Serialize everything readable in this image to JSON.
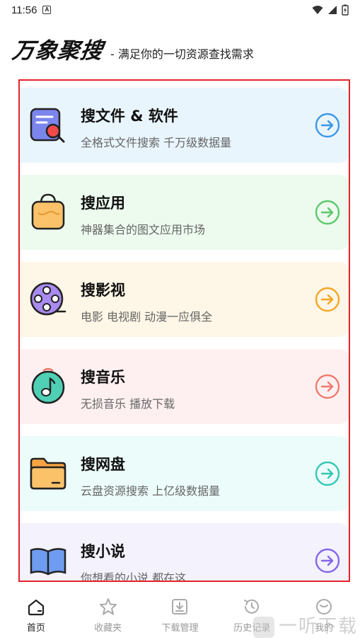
{
  "status_bar": {
    "time": "11:56",
    "notification_glyph": "A"
  },
  "header": {
    "title": "万象聚搜",
    "subtitle": "- 满足你的一切资源查找需求"
  },
  "cards": [
    {
      "title": "搜文件 & 软件",
      "desc": "全格式文件搜索 千万级数据量",
      "icon": "file-search-icon",
      "bg": "#e9f5fd",
      "accent": "#3a97e8"
    },
    {
      "title": "搜应用",
      "desc": "神器集合的图文应用市场",
      "icon": "shopping-bag-icon",
      "bg": "#edfbef",
      "accent": "#5cc86a"
    },
    {
      "title": "搜影视",
      "desc": "电影 电视剧 动漫一应俱全",
      "icon": "film-reel-icon",
      "bg": "#fef6e6",
      "accent": "#f5a623"
    },
    {
      "title": "搜音乐",
      "desc": "无损音乐 播放下载",
      "icon": "music-note-icon",
      "bg": "#fef0f0",
      "accent": "#f07b6e"
    },
    {
      "title": "搜网盘",
      "desc": "云盘资源搜索 上亿级数据量",
      "icon": "folder-icon",
      "bg": "#ecfcfa",
      "accent": "#33c7b2"
    },
    {
      "title": "搜小说",
      "desc": "你想看的小说 都在这",
      "icon": "book-icon",
      "bg": "#f3f2fd",
      "accent": "#8565e8"
    }
  ],
  "nav": [
    {
      "label": "首页",
      "icon": "home-icon",
      "active": true
    },
    {
      "label": "收藏夹",
      "icon": "star-icon",
      "active": false
    },
    {
      "label": "下载管理",
      "icon": "download-icon",
      "active": false
    },
    {
      "label": "历史记录",
      "icon": "history-icon",
      "active": false
    },
    {
      "label": "我的",
      "icon": "profile-icon",
      "active": false
    }
  ],
  "watermark": "一听下载"
}
